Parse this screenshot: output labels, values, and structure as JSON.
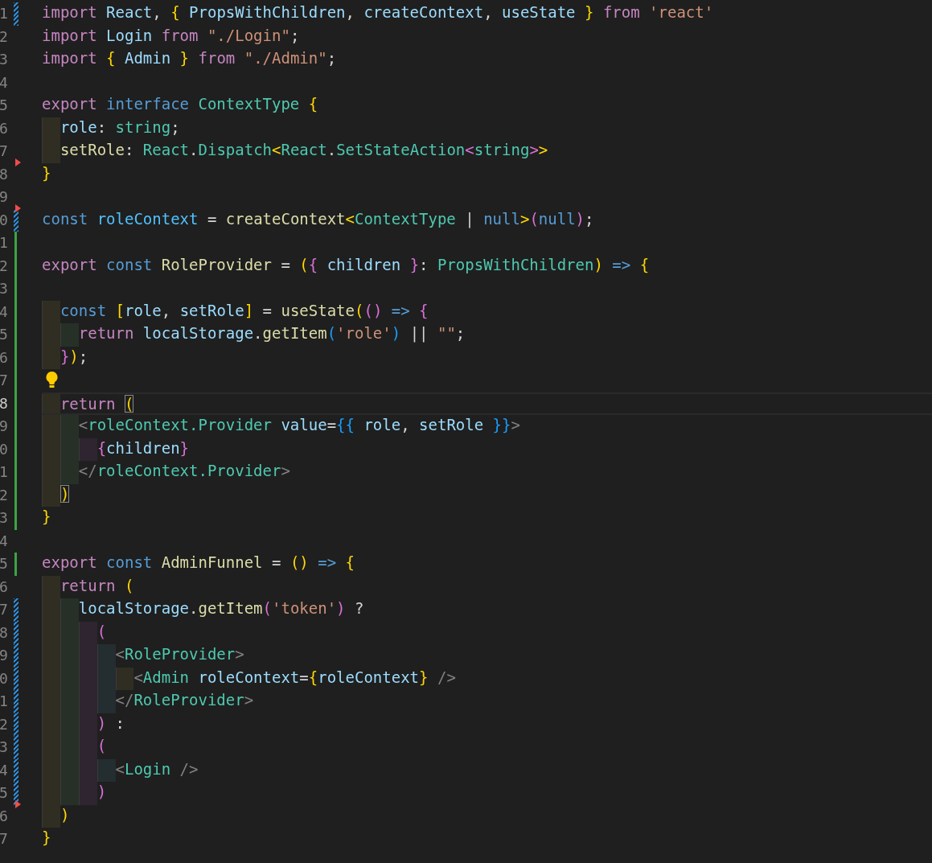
{
  "lines": [
    {
      "number": "1",
      "modified": true,
      "added": false,
      "deleted_above": false,
      "current": false,
      "lightbulb": false,
      "tokens": [
        {
          "kind": "kw",
          "text": "import "
        },
        {
          "kind": "var",
          "text": "React"
        },
        {
          "kind": "plain",
          "text": ", "
        },
        {
          "kind": "b1",
          "text": "{"
        },
        {
          "kind": "var",
          "text": " PropsWithChildren"
        },
        {
          "kind": "plain",
          "text": ", "
        },
        {
          "kind": "var",
          "text": "createContext"
        },
        {
          "kind": "plain",
          "text": ", "
        },
        {
          "kind": "var",
          "text": "useState "
        },
        {
          "kind": "b1",
          "text": "}"
        },
        {
          "kind": "kw",
          "text": " from "
        },
        {
          "kind": "str",
          "text": "'react'"
        }
      ]
    },
    {
      "number": "2",
      "modified": false,
      "added": false,
      "deleted_above": false,
      "current": false,
      "lightbulb": false,
      "tokens": [
        {
          "kind": "kw",
          "text": "import "
        },
        {
          "kind": "var",
          "text": "Login "
        },
        {
          "kind": "kw",
          "text": "from "
        },
        {
          "kind": "str",
          "text": "\"./Login\""
        },
        {
          "kind": "plain",
          "text": ";"
        }
      ]
    },
    {
      "number": "3",
      "modified": false,
      "added": false,
      "deleted_above": false,
      "current": false,
      "lightbulb": false,
      "tokens": [
        {
          "kind": "kw",
          "text": "import "
        },
        {
          "kind": "b1",
          "text": "{"
        },
        {
          "kind": "var",
          "text": " Admin "
        },
        {
          "kind": "b1",
          "text": "}"
        },
        {
          "kind": "kw",
          "text": " from "
        },
        {
          "kind": "str",
          "text": "\"./Admin\""
        },
        {
          "kind": "plain",
          "text": ";"
        }
      ]
    },
    {
      "number": "4",
      "modified": false,
      "added": false,
      "deleted_above": false,
      "current": false,
      "lightbulb": false
    },
    {
      "number": "5",
      "modified": false,
      "added": false,
      "deleted_above": false,
      "current": false,
      "lightbulb": false,
      "tokens": [
        {
          "kind": "kw",
          "text": "export "
        },
        {
          "kind": "storage",
          "text": "interface "
        },
        {
          "kind": "type",
          "text": "ContextType "
        },
        {
          "kind": "b1",
          "text": "{"
        }
      ]
    },
    {
      "number": "6",
      "modified": false,
      "added": false,
      "deleted_above": false,
      "current": false,
      "lightbulb": false,
      "guides": [
        {
          "color": "#302e22"
        }
      ],
      "tokens": [
        {
          "kind": "var",
          "text": "role"
        },
        {
          "kind": "plain",
          "text": ": "
        },
        {
          "kind": "type",
          "text": "string"
        },
        {
          "kind": "plain",
          "text": ";"
        }
      ]
    },
    {
      "number": "7",
      "modified": false,
      "added": false,
      "deleted_above": false,
      "current": false,
      "lightbulb": false,
      "guides": [
        {
          "color": "#302e22"
        }
      ],
      "tokens": [
        {
          "kind": "fn",
          "text": "setRole"
        },
        {
          "kind": "plain",
          "text": ": "
        },
        {
          "kind": "type",
          "text": "React"
        },
        {
          "kind": "plain",
          "text": "."
        },
        {
          "kind": "type",
          "text": "Dispatch"
        },
        {
          "kind": "b1",
          "text": "<"
        },
        {
          "kind": "type",
          "text": "React"
        },
        {
          "kind": "plain",
          "text": "."
        },
        {
          "kind": "type",
          "text": "SetStateAction"
        },
        {
          "kind": "b2",
          "text": "<"
        },
        {
          "kind": "type",
          "text": "string"
        },
        {
          "kind": "b2",
          "text": ">"
        },
        {
          "kind": "b1",
          "text": ">"
        }
      ]
    },
    {
      "number": "8",
      "modified": false,
      "added": false,
      "deleted_above": true,
      "current": false,
      "lightbulb": false,
      "tokens": [
        {
          "kind": "b1",
          "text": "}"
        }
      ]
    },
    {
      "number": "9",
      "modified": false,
      "added": false,
      "deleted_above": false,
      "current": false,
      "lightbulb": false
    },
    {
      "number": "0",
      "modified": true,
      "added": false,
      "deleted_above": true,
      "current": false,
      "lightbulb": false,
      "tokens": [
        {
          "kind": "storage",
          "text": "const "
        },
        {
          "kind": "const",
          "text": "roleContext"
        },
        {
          "kind": "plain",
          "text": " = "
        },
        {
          "kind": "fn",
          "text": "createContext"
        },
        {
          "kind": "b1",
          "text": "<"
        },
        {
          "kind": "type",
          "text": "ContextType "
        },
        {
          "kind": "plain",
          "text": "| "
        },
        {
          "kind": "storage",
          "text": "null"
        },
        {
          "kind": "b1",
          "text": ">"
        },
        {
          "kind": "b2",
          "text": "("
        },
        {
          "kind": "storage",
          "text": "null"
        },
        {
          "kind": "b2",
          "text": ")"
        },
        {
          "kind": "plain",
          "text": ";"
        }
      ]
    },
    {
      "number": "1",
      "modified": false,
      "added": true,
      "deleted_above": false,
      "current": false,
      "lightbulb": false
    },
    {
      "number": "2",
      "modified": false,
      "added": true,
      "deleted_above": false,
      "current": false,
      "lightbulb": false,
      "tokens": [
        {
          "kind": "kw",
          "text": "export "
        },
        {
          "kind": "storage",
          "text": "const "
        },
        {
          "kind": "fn",
          "text": "RoleProvider"
        },
        {
          "kind": "plain",
          "text": " = "
        },
        {
          "kind": "b1",
          "text": "("
        },
        {
          "kind": "b2",
          "text": "{"
        },
        {
          "kind": "var",
          "text": " children "
        },
        {
          "kind": "b2",
          "text": "}"
        },
        {
          "kind": "plain",
          "text": ": "
        },
        {
          "kind": "type",
          "text": "PropsWithChildren"
        },
        {
          "kind": "b1",
          "text": ")"
        },
        {
          "kind": "storage",
          "text": " => "
        },
        {
          "kind": "b1",
          "text": "{"
        }
      ]
    },
    {
      "number": "3",
      "modified": false,
      "added": true,
      "deleted_above": false,
      "current": false,
      "lightbulb": false
    },
    {
      "number": "4",
      "modified": false,
      "added": true,
      "deleted_above": false,
      "current": false,
      "lightbulb": false,
      "guides": [
        {
          "color": "#302e22"
        }
      ],
      "tokens": [
        {
          "kind": "storage",
          "text": "const "
        },
        {
          "kind": "b1",
          "text": "["
        },
        {
          "kind": "var",
          "text": "role"
        },
        {
          "kind": "plain",
          "text": ", "
        },
        {
          "kind": "var",
          "text": "setRole"
        },
        {
          "kind": "b1",
          "text": "]"
        },
        {
          "kind": "plain",
          "text": " = "
        },
        {
          "kind": "fn",
          "text": "useState"
        },
        {
          "kind": "b1",
          "text": "("
        },
        {
          "kind": "b2",
          "text": "()"
        },
        {
          "kind": "storage",
          "text": " => "
        },
        {
          "kind": "b2",
          "text": "{"
        }
      ]
    },
    {
      "number": "5",
      "modified": false,
      "added": true,
      "deleted_above": false,
      "current": false,
      "lightbulb": false,
      "guides": [
        {
          "color": "#302e22"
        },
        {
          "color": "#263027"
        }
      ],
      "tokens": [
        {
          "kind": "kw",
          "text": "return "
        },
        {
          "kind": "var",
          "text": "localStorage"
        },
        {
          "kind": "plain",
          "text": "."
        },
        {
          "kind": "fn",
          "text": "getItem"
        },
        {
          "kind": "b3",
          "text": "("
        },
        {
          "kind": "str",
          "text": "'role'"
        },
        {
          "kind": "b3",
          "text": ")"
        },
        {
          "kind": "plain",
          "text": " || "
        },
        {
          "kind": "str",
          "text": "\"\""
        },
        {
          "kind": "plain",
          "text": ";"
        }
      ]
    },
    {
      "number": "6",
      "modified": false,
      "added": true,
      "deleted_above": false,
      "current": false,
      "lightbulb": false,
      "guides": [
        {
          "color": "#302e22"
        }
      ],
      "tokens": [
        {
          "kind": "b2",
          "text": "}"
        },
        {
          "kind": "b1",
          "text": ")"
        },
        {
          "kind": "plain",
          "text": ";"
        }
      ]
    },
    {
      "number": "7",
      "modified": false,
      "added": true,
      "deleted_above": false,
      "current": false,
      "lightbulb": true
    },
    {
      "number": "8",
      "modified": false,
      "added": true,
      "deleted_above": false,
      "current": true,
      "lightbulb": false,
      "guides": [
        {
          "color": "#302e22"
        }
      ],
      "tokens": [
        {
          "kind": "kw",
          "text": "return "
        },
        {
          "kind": "b1_matched",
          "text": "("
        }
      ]
    },
    {
      "number": "9",
      "modified": false,
      "added": true,
      "deleted_above": false,
      "current": false,
      "lightbulb": false,
      "guides": [
        {
          "color": "#302e22"
        },
        {
          "color": "#263027"
        }
      ],
      "tokens": [
        {
          "kind": "tag",
          "text": "<"
        },
        {
          "kind": "type",
          "text": "roleContext.Provider"
        },
        {
          "kind": "var",
          "text": " value"
        },
        {
          "kind": "plain",
          "text": "="
        },
        {
          "kind": "b3",
          "text": "{{"
        },
        {
          "kind": "var",
          "text": " role"
        },
        {
          "kind": "plain",
          "text": ", "
        },
        {
          "kind": "var",
          "text": "setRole "
        },
        {
          "kind": "b3",
          "text": "}}"
        },
        {
          "kind": "tag",
          "text": ">"
        }
      ]
    },
    {
      "number": "0",
      "modified": false,
      "added": true,
      "deleted_above": false,
      "current": false,
      "lightbulb": false,
      "guides": [
        {
          "color": "#302e22"
        },
        {
          "color": "#263027"
        },
        {
          "color": "#2e2530"
        }
      ],
      "tokens": [
        {
          "kind": "b2",
          "text": "{"
        },
        {
          "kind": "var",
          "text": "children"
        },
        {
          "kind": "b2",
          "text": "}"
        }
      ]
    },
    {
      "number": "1",
      "modified": false,
      "added": true,
      "deleted_above": false,
      "current": false,
      "lightbulb": false,
      "guides": [
        {
          "color": "#302e22"
        },
        {
          "color": "#263027"
        }
      ],
      "tokens": [
        {
          "kind": "tag",
          "text": "</"
        },
        {
          "kind": "type",
          "text": "roleContext.Provider"
        },
        {
          "kind": "tag",
          "text": ">"
        }
      ]
    },
    {
      "number": "2",
      "modified": false,
      "added": true,
      "deleted_above": false,
      "current": false,
      "lightbulb": false,
      "guides": [
        {
          "color": "#302e22"
        }
      ],
      "tokens": [
        {
          "kind": "b1_matched",
          "text": ")"
        }
      ]
    },
    {
      "number": "3",
      "modified": false,
      "added": true,
      "deleted_above": false,
      "current": false,
      "lightbulb": false,
      "tokens": [
        {
          "kind": "b1",
          "text": "}"
        }
      ]
    },
    {
      "number": "4",
      "modified": false,
      "added": false,
      "deleted_above": false,
      "current": false,
      "lightbulb": false
    },
    {
      "number": "5",
      "modified": false,
      "added": true,
      "deleted_above": false,
      "current": false,
      "lightbulb": false,
      "tokens": [
        {
          "kind": "kw",
          "text": "export "
        },
        {
          "kind": "storage",
          "text": "const "
        },
        {
          "kind": "fn",
          "text": "AdminFunnel"
        },
        {
          "kind": "plain",
          "text": " = "
        },
        {
          "kind": "b1",
          "text": "()"
        },
        {
          "kind": "storage",
          "text": " => "
        },
        {
          "kind": "b1",
          "text": "{"
        }
      ]
    },
    {
      "number": "6",
      "modified": false,
      "added": false,
      "deleted_above": false,
      "current": false,
      "lightbulb": false,
      "guides": [
        {
          "color": "#302e22"
        }
      ],
      "tokens": [
        {
          "kind": "kw",
          "text": "return "
        },
        {
          "kind": "b1",
          "text": "("
        }
      ]
    },
    {
      "number": "7",
      "modified": true,
      "added": false,
      "deleted_above": false,
      "current": false,
      "lightbulb": false,
      "guides": [
        {
          "color": "#302e22"
        },
        {
          "color": "#263027"
        }
      ],
      "tokens": [
        {
          "kind": "var",
          "text": "localStorage"
        },
        {
          "kind": "plain",
          "text": "."
        },
        {
          "kind": "fn",
          "text": "getItem"
        },
        {
          "kind": "b2",
          "text": "("
        },
        {
          "kind": "str",
          "text": "'token'"
        },
        {
          "kind": "b2",
          "text": ")"
        },
        {
          "kind": "plain",
          "text": " ?"
        }
      ]
    },
    {
      "number": "8",
      "modified": true,
      "added": false,
      "deleted_above": false,
      "current": false,
      "lightbulb": false,
      "guides": [
        {
          "color": "#302e22"
        },
        {
          "color": "#263027"
        },
        {
          "color": "#2e2530"
        }
      ],
      "tokens": [
        {
          "kind": "b2",
          "text": "("
        }
      ]
    },
    {
      "number": "9",
      "modified": true,
      "added": false,
      "deleted_above": false,
      "current": false,
      "lightbulb": false,
      "guides": [
        {
          "color": "#302e22"
        },
        {
          "color": "#263027"
        },
        {
          "color": "#2e2530"
        },
        {
          "color": "#242d2f"
        }
      ],
      "tokens": [
        {
          "kind": "tag",
          "text": "<"
        },
        {
          "kind": "type",
          "text": "RoleProvider"
        },
        {
          "kind": "tag",
          "text": ">"
        }
      ]
    },
    {
      "number": "0",
      "modified": true,
      "added": false,
      "deleted_above": false,
      "current": false,
      "lightbulb": false,
      "guides": [
        {
          "color": "#302e22"
        },
        {
          "color": "#263027"
        },
        {
          "color": "#2e2530"
        },
        {
          "color": "#242d2f"
        },
        {
          "color": "#302e22"
        }
      ],
      "tokens": [
        {
          "kind": "tag",
          "text": "<"
        },
        {
          "kind": "type",
          "text": "Admin "
        },
        {
          "kind": "var",
          "text": "roleContext"
        },
        {
          "kind": "plain",
          "text": "="
        },
        {
          "kind": "b1",
          "text": "{"
        },
        {
          "kind": "var",
          "text": "roleContext"
        },
        {
          "kind": "b1",
          "text": "}"
        },
        {
          "kind": "tag",
          "text": " />"
        }
      ]
    },
    {
      "number": "1",
      "modified": true,
      "added": false,
      "deleted_above": false,
      "current": false,
      "lightbulb": false,
      "guides": [
        {
          "color": "#302e22"
        },
        {
          "color": "#263027"
        },
        {
          "color": "#2e2530"
        },
        {
          "color": "#242d2f"
        }
      ],
      "tokens": [
        {
          "kind": "tag",
          "text": "</"
        },
        {
          "kind": "type",
          "text": "RoleProvider"
        },
        {
          "kind": "tag",
          "text": ">"
        }
      ]
    },
    {
      "number": "2",
      "modified": true,
      "added": false,
      "deleted_above": false,
      "current": false,
      "lightbulb": false,
      "guides": [
        {
          "color": "#302e22"
        },
        {
          "color": "#263027"
        },
        {
          "color": "#2e2530"
        }
      ],
      "tokens": [
        {
          "kind": "b2",
          "text": ")"
        },
        {
          "kind": "plain",
          "text": " :"
        }
      ]
    },
    {
      "number": "3",
      "modified": true,
      "added": false,
      "deleted_above": false,
      "current": false,
      "lightbulb": false,
      "guides": [
        {
          "color": "#302e22"
        },
        {
          "color": "#263027"
        },
        {
          "color": "#2e2530"
        }
      ],
      "tokens": [
        {
          "kind": "b2",
          "text": "("
        }
      ]
    },
    {
      "number": "4",
      "modified": true,
      "added": false,
      "deleted_above": false,
      "current": false,
      "lightbulb": false,
      "guides": [
        {
          "color": "#302e22"
        },
        {
          "color": "#263027"
        },
        {
          "color": "#2e2530"
        },
        {
          "color": "#242d2f"
        }
      ],
      "tokens": [
        {
          "kind": "tag",
          "text": "<"
        },
        {
          "kind": "type",
          "text": "Login "
        },
        {
          "kind": "tag",
          "text": "/>"
        }
      ]
    },
    {
      "number": "5",
      "modified": true,
      "added": false,
      "deleted_above": false,
      "current": false,
      "lightbulb": false,
      "guides": [
        {
          "color": "#302e22"
        },
        {
          "color": "#263027"
        },
        {
          "color": "#2e2530"
        }
      ],
      "tokens": [
        {
          "kind": "b2",
          "text": ")"
        }
      ]
    },
    {
      "number": "6",
      "modified": false,
      "added": false,
      "deleted_above": true,
      "current": false,
      "lightbulb": false,
      "guides": [
        {
          "color": "#302e22"
        }
      ],
      "tokens": [
        {
          "kind": "b1",
          "text": ")"
        }
      ]
    },
    {
      "number": "7",
      "modified": false,
      "added": false,
      "deleted_above": false,
      "current": false,
      "lightbulb": false,
      "tokens": [
        {
          "kind": "b1",
          "text": "}"
        }
      ]
    }
  ]
}
